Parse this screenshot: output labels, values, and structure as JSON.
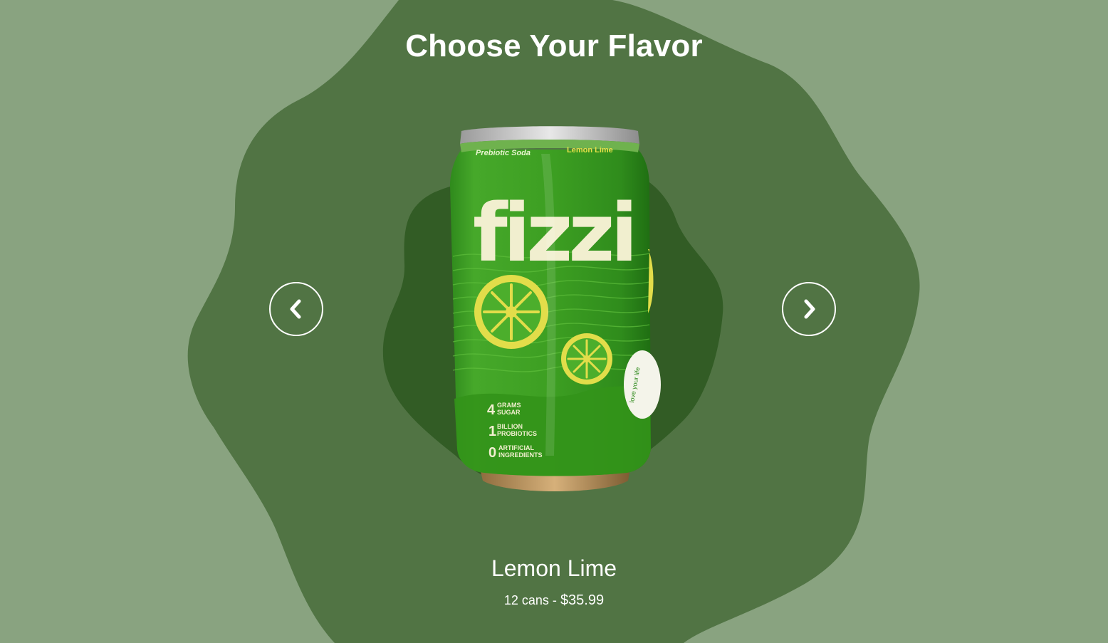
{
  "page": {
    "heading": "Choose Your Flavor"
  },
  "carousel": {
    "prev_icon": "chevron-left-icon",
    "next_icon": "chevron-right-icon"
  },
  "product": {
    "can": {
      "tagline": "Prebiotic Soda",
      "flavor_label": "Lemon Lime",
      "brand": "fizzi",
      "stat_1_number": "4",
      "stat_1_line1": "GRAMS",
      "stat_1_line2": "SUGAR",
      "stat_2_number": "1",
      "stat_2_line1": "BILLION",
      "stat_2_line2": "PROBIOTICS",
      "stat_3_number": "0",
      "stat_3_line1": "ARTIFICIAL",
      "stat_3_line2": "INGREDIENTS",
      "badge": "love your life"
    },
    "name": "Lemon Lime",
    "quantity": "12 cans - ",
    "price": "$35.99"
  },
  "colors": {
    "page_background": "#89a380",
    "blob_mid": "#517444",
    "blob_dark": "#325c25",
    "can_green": "#3fa324",
    "lemon_yellow": "#e2dd4a",
    "text": "#ffffff"
  }
}
